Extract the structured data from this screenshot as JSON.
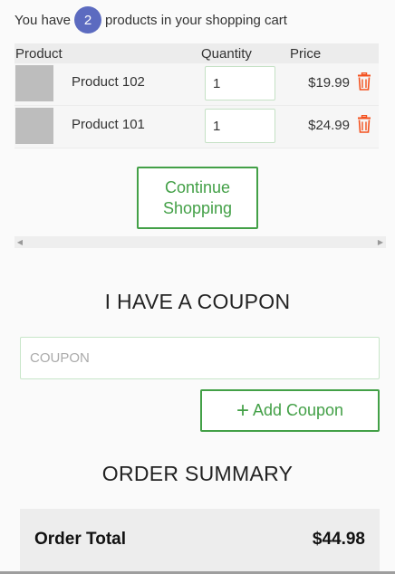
{
  "cart": {
    "summary_prefix": "You have",
    "item_count": "2",
    "summary_suffix": "products in your shopping cart"
  },
  "table": {
    "headers": {
      "product": "Product",
      "quantity": "Quantity",
      "price": "Price"
    },
    "rows": [
      {
        "name": "Product 102",
        "quantity": "1",
        "price": "$19.99"
      },
      {
        "name": "Product 101",
        "quantity": "1",
        "price": "$24.99"
      }
    ]
  },
  "actions": {
    "continue_label": "Continue\nShopping"
  },
  "coupon": {
    "heading": "I HAVE A COUPON",
    "placeholder": "COUPON",
    "value": "",
    "add_label": "Add Coupon"
  },
  "summary": {
    "heading": "ORDER SUMMARY",
    "total_label": "Order Total",
    "total_value": "$44.98"
  },
  "icons": {
    "delete": "trash-icon",
    "add": "plus-icon",
    "scroll_left": "chevron-left-icon",
    "scroll_right": "chevron-right-icon"
  },
  "colors": {
    "accent_green": "#43a047",
    "badge_blue": "#5c6bc0",
    "delete_orange": "#f4511e"
  }
}
